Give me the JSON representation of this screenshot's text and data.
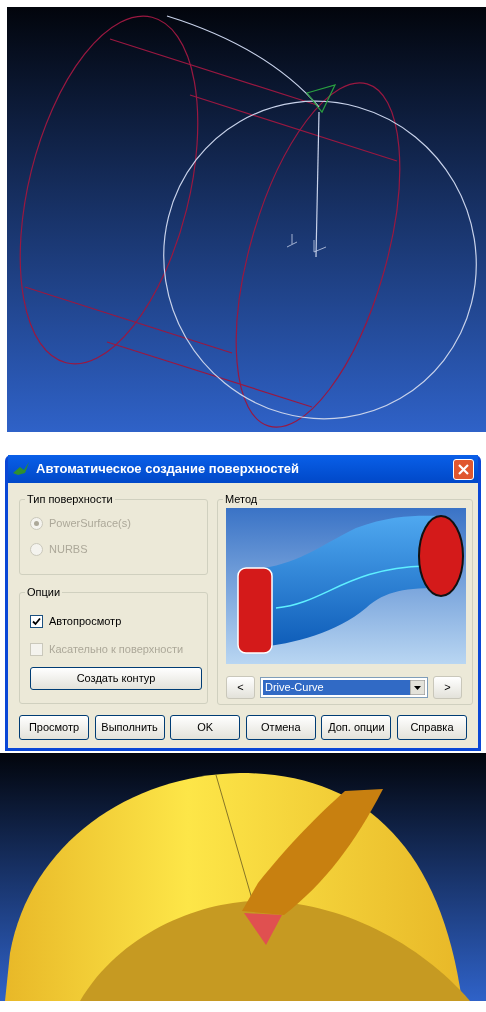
{
  "dialog": {
    "title": "Автоматическое создание поверхностей",
    "surface_type": {
      "label": "Тип поверхности",
      "options": [
        {
          "label": "PowerSurface(s)",
          "selected": true,
          "disabled": true
        },
        {
          "label": "NURBS",
          "selected": false,
          "disabled": true
        }
      ]
    },
    "options": {
      "label": "Опции",
      "checkboxes": [
        {
          "label": "Автопросмотр",
          "checked": true,
          "disabled": false
        },
        {
          "label": "Касательно к поверхности",
          "checked": false,
          "disabled": true
        }
      ],
      "button": "Создать контур"
    },
    "method": {
      "label": "Метод",
      "prev": {
        "label": "<",
        "disabled": true
      },
      "select": {
        "value": "Drive-Curve"
      },
      "next": {
        "label": ">",
        "disabled": true
      }
    },
    "buttons": [
      "Просмотр",
      "Выполнить",
      "OK",
      "Отмена",
      "Доп. опции",
      "Справка"
    ]
  }
}
